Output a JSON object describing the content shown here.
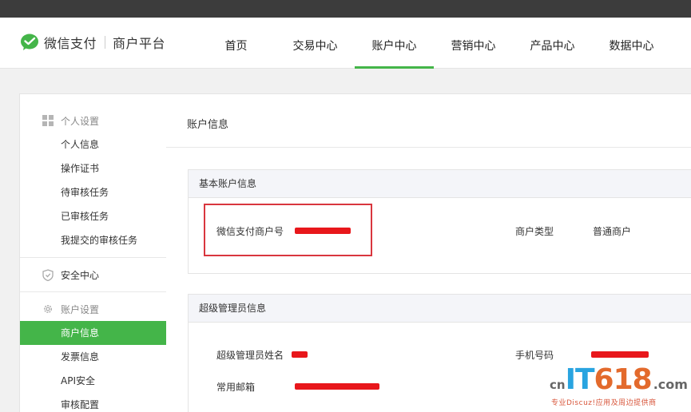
{
  "brand": {
    "name": "微信支付",
    "sub": "商户平台",
    "color": "#44b549"
  },
  "nav": {
    "items": [
      {
        "label": "首页"
      },
      {
        "label": "交易中心"
      },
      {
        "label": "账户中心"
      },
      {
        "label": "营销中心"
      },
      {
        "label": "产品中心"
      },
      {
        "label": "数据中心"
      }
    ],
    "active": "账户中心"
  },
  "sidebar": {
    "personal": {
      "title": "个人设置",
      "items": [
        "个人信息",
        "操作证书",
        "待审核任务",
        "已审核任务",
        "我提交的审核任务"
      ]
    },
    "security": {
      "label": "安全中心"
    },
    "account": {
      "title": "账户设置",
      "items": [
        "商户信息",
        "发票信息",
        "API安全",
        "审核配置"
      ],
      "active": "商户信息"
    }
  },
  "main": {
    "title": "账户信息",
    "basic": {
      "header": "基本账户信息",
      "merchant_id_label": "微信支付商户号",
      "merchant_type_label": "商户类型",
      "merchant_type_value": "普通商户"
    },
    "admin": {
      "header": "超级管理员信息",
      "name_label": "超级管理员姓名",
      "phone_label": "手机号码",
      "email_label": "常用邮箱"
    }
  },
  "watermark": {
    "cn": "cn",
    "it": "IT",
    "num": "618",
    "com": ".com",
    "sub": "专业Discuz!应用及周边提供商"
  }
}
